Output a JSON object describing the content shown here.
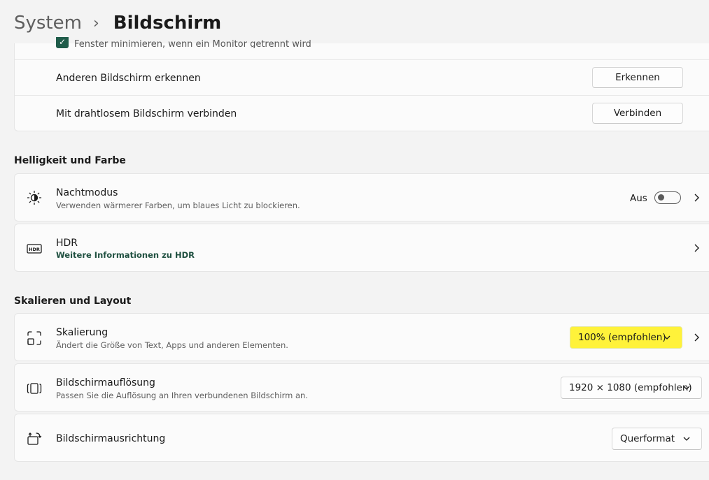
{
  "breadcrumb": {
    "parent": "System",
    "separator": "›",
    "current": "Bildschirm"
  },
  "top_group": {
    "partial_row_text": "Fenster minimieren, wenn ein Monitor getrennt wird",
    "detect": {
      "label": "Anderen Bildschirm erkennen",
      "button": "Erkennen"
    },
    "wireless": {
      "label": "Mit drahtlosem Bildschirm verbinden",
      "button": "Verbinden"
    }
  },
  "brightness_section": {
    "title": "Helligkeit und Farbe",
    "night_mode": {
      "label": "Nachtmodus",
      "description": "Verwenden wärmerer Farben, um blaues Licht zu blockieren.",
      "state_label": "Aus",
      "enabled": false
    },
    "hdr": {
      "label": "HDR",
      "link": "Weitere Informationen zu HDR",
      "icon_text": "HDR"
    }
  },
  "layout_section": {
    "title": "Skalieren und Layout",
    "scaling": {
      "label": "Skalierung",
      "description": "Ändert die Größe von Text, Apps und anderen Elementen.",
      "value": "100% (empfohlen)"
    },
    "resolution": {
      "label": "Bildschirmauflösung",
      "description": "Passen Sie die Auflösung an Ihren verbundenen Bildschirm an.",
      "value": "1920 × 1080 (empfohlen)"
    },
    "orientation": {
      "label": "Bildschirmausrichtung",
      "value": "Querformat"
    }
  },
  "colors": {
    "accent": "#1f5c4a",
    "highlight": "#fff23a",
    "card": "#fbfbfb",
    "background": "#f3f3f3"
  }
}
